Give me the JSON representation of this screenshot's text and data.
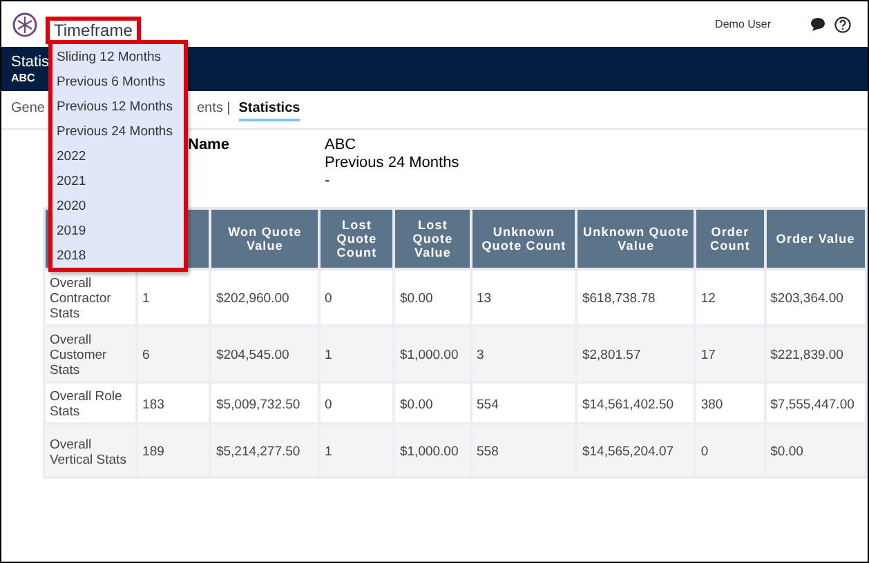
{
  "header": {
    "timeframe_label": "Timeframe",
    "user": "Demo User"
  },
  "timeframe_menu": [
    "Sliding 12 Months",
    "Previous 6 Months",
    "Previous 12 Months",
    "Previous 24 Months",
    "2022",
    "2021",
    "2020",
    "2019",
    "2018"
  ],
  "banner": {
    "title": "Statis",
    "subtitle": "ABC"
  },
  "tabs": [
    {
      "label": "Gene",
      "selected": false
    },
    {
      "label": "ents |",
      "selected": false
    },
    {
      "label": "Statistics",
      "selected": true
    }
  ],
  "info": {
    "label": "Name",
    "values": [
      "ABC",
      "Previous 24 Months",
      "-"
    ]
  },
  "table": {
    "columns": [
      "",
      "",
      "Won Quote Value",
      "Lost Quote Count",
      "Lost Quote Value",
      "Unknown Quote Count",
      "Unknown Quote Value",
      "Order Count",
      "Order Value"
    ],
    "rows": [
      [
        "Overall Contractor Stats",
        "1",
        "$202,960.00",
        "0",
        "$0.00",
        "13",
        "$618,738.78",
        "12",
        "$203,364.00"
      ],
      [
        "Overall Customer Stats",
        "6",
        "$204,545.00",
        "1",
        "$1,000.00",
        "3",
        "$2,801.57",
        "17",
        "$221,839.00"
      ],
      [
        "Overall Role Stats",
        "183",
        "$5,009,732.50",
        "0",
        "$0.00",
        "554",
        "$14,561,402.50",
        "380",
        "$7,555,447.00"
      ],
      [
        "Overall Vertical Stats",
        "189",
        "$5,214,277.50",
        "1",
        "$1,000.00",
        "558",
        "$14,565,204.07",
        "0",
        "$0.00"
      ]
    ]
  }
}
